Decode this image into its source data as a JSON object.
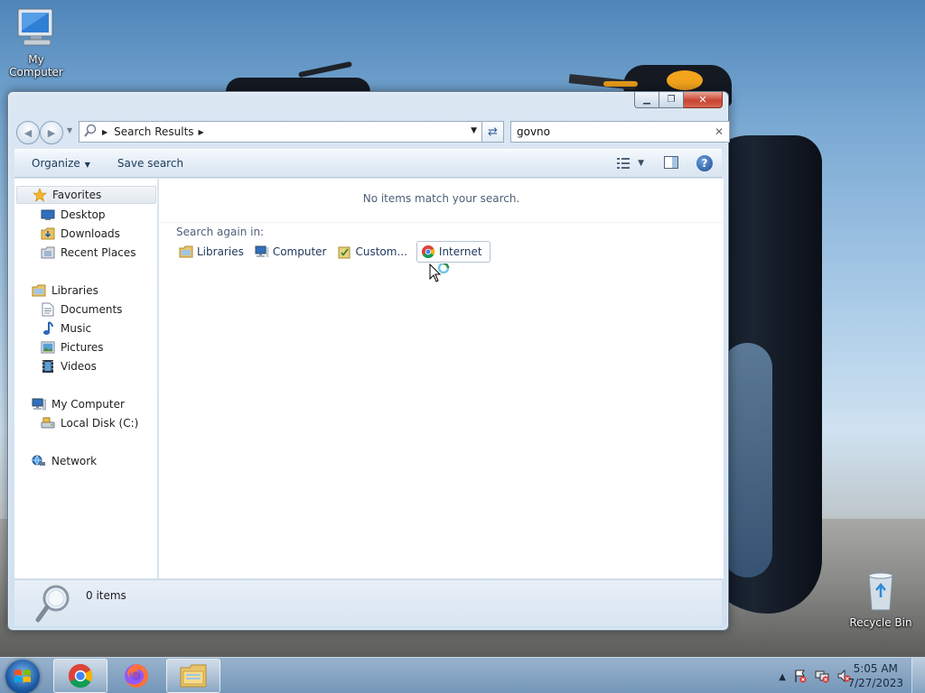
{
  "desktop": {
    "icons": [
      {
        "label": "My Computer"
      },
      {
        "label": "Recycle Bin"
      }
    ]
  },
  "window": {
    "caption_buttons": {
      "minimize": "minimize-icon",
      "maximize": "maximize-icon",
      "close": "close-icon"
    },
    "address": {
      "crumb": "Search Results"
    },
    "search": {
      "value": "govno"
    },
    "toolbar": {
      "organize_label": "Organize",
      "save_search_label": "Save search"
    },
    "nav_pane": {
      "favorites": {
        "label": "Favorites",
        "items": [
          "Desktop",
          "Downloads",
          "Recent Places"
        ]
      },
      "libraries": {
        "label": "Libraries",
        "items": [
          "Documents",
          "Music",
          "Pictures",
          "Videos"
        ]
      },
      "computer": {
        "label": "My Computer",
        "items": [
          "Local Disk (C:)"
        ]
      },
      "network": {
        "label": "Network"
      }
    },
    "content": {
      "no_items": "No items match your search.",
      "search_again_label": "Search again in:",
      "search_again_links": [
        {
          "label": "Libraries",
          "icon": "library-folder-icon"
        },
        {
          "label": "Computer",
          "icon": "computer-icon"
        },
        {
          "label": "Custom...",
          "icon": "custom-folder-icon"
        },
        {
          "label": "Internet",
          "icon": "chrome-icon"
        }
      ]
    },
    "details": {
      "count": "0 items"
    }
  },
  "taskbar": {
    "apps": [
      "chrome-icon",
      "firefox-icon",
      "explorer-icon"
    ],
    "clock": {
      "time": "5:05 AM",
      "date": "7/27/2023"
    }
  },
  "colors": {
    "accent": "#1e395b",
    "window_frame": "#cfe0f0",
    "taskbar": "#8fb3d6"
  }
}
